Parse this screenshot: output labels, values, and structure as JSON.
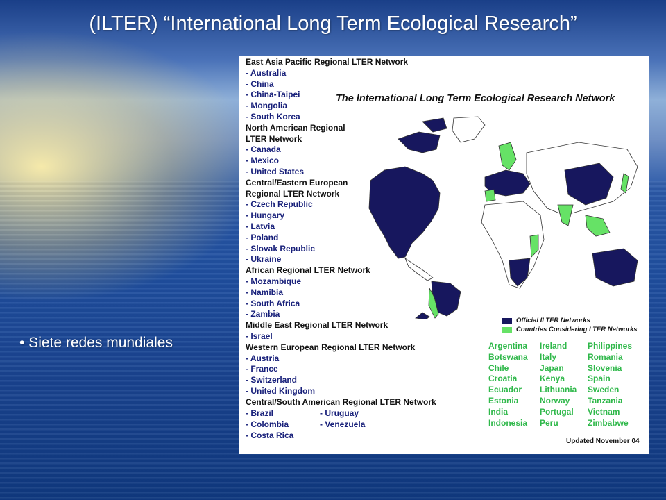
{
  "slide": {
    "title": "(ILTER) “International Long Term Ecological Research”",
    "bullet": "• Siete redes mundiales"
  },
  "figure": {
    "map_title": "The  International Long Term Ecological Research Network",
    "networks": [
      {
        "name": "East Asia Pacific Regional LTER Network",
        "countries": [
          "- Australia",
          "- China",
          "- China-Taipei",
          "- Mongolia",
          "- South Korea"
        ]
      },
      {
        "name_lines": [
          "North American Regional",
          "LTER Network"
        ],
        "countries": [
          "- Canada",
          "- Mexico",
          "- United States"
        ]
      },
      {
        "name_lines": [
          "Central/Eastern European",
          "Regional LTER Network"
        ],
        "countries": [
          "- Czech Republic",
          "- Hungary",
          "- Latvia",
          "- Poland",
          "- Slovak Republic",
          "- Ukraine"
        ]
      },
      {
        "name": "African Regional LTER Network",
        "countries": [
          "- Mozambique",
          "- Namibia",
          "- South Africa",
          "- Zambia"
        ]
      },
      {
        "name": "Middle East Regional LTER Network",
        "countries": [
          "- Israel"
        ]
      },
      {
        "name": "Western European Regional LTER Network",
        "countries": [
          "- Austria",
          "- France",
          "- Switzerland",
          "- United Kingdom"
        ]
      },
      {
        "name": "Central/South American Regional LTER Network",
        "countries_left": [
          "- Brazil",
          "- Colombia",
          "- Costa Rica"
        ],
        "countries_right": [
          "- Uruguay",
          "- Venezuela"
        ]
      }
    ],
    "legend": {
      "official": "Official ILTER Networks",
      "considering": "Countries Considering LTER Networks",
      "official_color": "#17175e",
      "considering_color": "#66e266"
    },
    "considering_countries": {
      "col1": [
        "Argentina",
        "Botswana",
        "Chile",
        "Croatia",
        "Ecuador",
        "Estonia",
        "India",
        "Indonesia"
      ],
      "col2": [
        "Ireland",
        "Italy",
        "Japan",
        "Kenya",
        "Lithuania",
        "Norway",
        "Portugal",
        "Peru"
      ],
      "col3": [
        "Philippines",
        "Romania",
        "Slovenia",
        "Spain",
        "Sweden",
        "Tanzania",
        "Vietnam",
        "Zimbabwe"
      ]
    },
    "updated": "Updated November 04"
  }
}
